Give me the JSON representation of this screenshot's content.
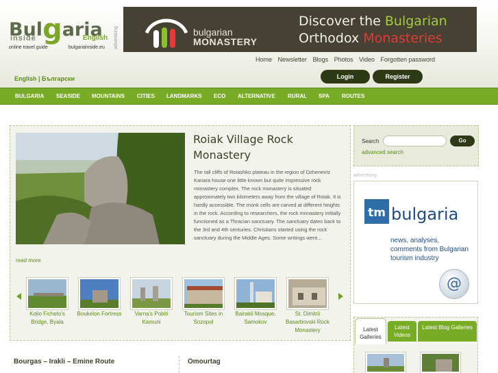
{
  "header": {
    "logo_part1": "Bul",
    "logo_part2": "g",
    "logo_part3": "aria",
    "logo_inside": "inside",
    "logo_english": "English",
    "logo_tagline": "online travel guide",
    "logo_url": "bulgariainside.eu",
    "advertising_vertical": "advertising"
  },
  "banner": {
    "brand_line1": "bulgarian",
    "brand_line2": "MONASTERY",
    "headline_line1_a": "Discover the ",
    "headline_line1_b": "Bulgarian",
    "headline_line2_a": "Orthodox ",
    "headline_line2_b": "Monasteries"
  },
  "topnav": [
    "Home",
    "Newsletter",
    "Blogs",
    "Photos",
    "Video",
    "Forgotten password"
  ],
  "language": {
    "label": "English | Български"
  },
  "auth": {
    "login": "Login",
    "register": "Register"
  },
  "mainnav": [
    "BULGARIA",
    "SEASIDE",
    "MOUNTAINS",
    "CITIES",
    "LANDMARKS",
    "ECO",
    "ALTERNATIVE",
    "RURAL",
    "SPA",
    "ROUTES"
  ],
  "feature": {
    "title": "Roiak Village Rock Monastery",
    "text": "The tall cliffs of Roiashko plateau in the region of DzhenevIz Kanara house one little known but quite impressive rock monastery complex. The rock monastery is situated approximately two kilometers away from the village of Roiak. It is hardly accessible. The monk cells are carved at different heights in the rock. According to researchers, the rock monastery initially functioned as a Thracian sanctuary. The sanctuary dates back to the 3rd and 4th centuries. Christians started using the rock sanctuary during the Middle Ages. Some writings were...",
    "read_more": "read more"
  },
  "thumbnails": [
    {
      "caption": "Kolio Ficheto's Bridge, Byala"
    },
    {
      "caption": "Boukelon Fortress"
    },
    {
      "caption": "Varna's Pobiti Kamuni"
    },
    {
      "caption": "Tourism Sites in Sozopol"
    },
    {
      "caption": "Bairakli Mosque, Samokov"
    },
    {
      "caption": "St. Dimitrii Basarbovski Rock Monastery"
    }
  ],
  "search": {
    "label": "Search",
    "placeholder": "",
    "button": "Go",
    "advanced": "advanced search"
  },
  "ad": {
    "label": "advertising",
    "logo_tm": "tm",
    "logo_word": "bulgaria",
    "text": "news, analyses, comments from Bulgarian tourism industry",
    "at_symbol": "@"
  },
  "gallery_tabs": {
    "galleries": "Latest Galleries",
    "videos": "Latest Videos",
    "blog": "Latest Blog Galleries"
  },
  "bottom": {
    "left_title": "Bourgas – Irakli – Emine Route",
    "right_title": "Omourtag"
  },
  "colors": {
    "nav_green": "#79ac26",
    "dark_button": "#2e3a16",
    "link_green": "#5b8b14",
    "banner_bg": "#454133"
  }
}
